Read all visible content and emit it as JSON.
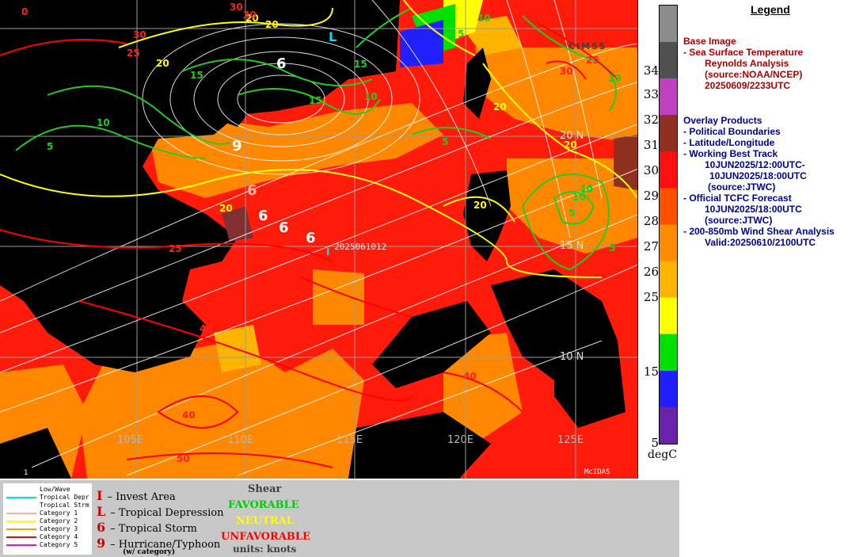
{
  "map": {
    "longitude_labels": [
      "105E",
      "110E",
      "115E",
      "120E",
      "125E"
    ],
    "latitude_labels": [
      "20 N",
      "15 N",
      "10 N"
    ],
    "track_label": "2025061012",
    "corner_label": "1",
    "footer_text": "McIDAS",
    "logo_text": "CIMSS",
    "shear_contour_labels": {
      "green": [
        "5",
        "10",
        "15",
        "10",
        "15",
        "10",
        "5",
        "10",
        "10",
        "15",
        "5",
        "5",
        "5",
        "10",
        "15"
      ],
      "yellow": [
        "20",
        "20",
        "20",
        "20",
        "20",
        "20",
        "20"
      ],
      "red": [
        "30",
        "30",
        "25",
        "25",
        "40",
        "40",
        "40",
        "50",
        "30",
        "25",
        "0",
        "30"
      ]
    }
  },
  "colorbar": {
    "ticks": [
      "34",
      "33",
      "32",
      "31",
      "30",
      "29",
      "28",
      "27",
      "26",
      "25",
      "15",
      "5"
    ],
    "unit": "degC",
    "colors": [
      "#8c8c8c",
      "#505050",
      "#c040c0",
      "#903020",
      "#ff1010",
      "#ff5000",
      "#ff8c00",
      "#ffb400",
      "#ffff00",
      "#00e000",
      "#2020ff",
      "#6a22aa"
    ]
  },
  "legend": {
    "title": "Legend",
    "base_image_header": "Base Image",
    "base_lines": [
      "-  Sea Surface Temperature",
      "Reynolds Analysis",
      "(source:NOAA/NCEP)",
      "20250609/2233UTC"
    ],
    "overlay_header": "Overlay Products",
    "overlay_lines": [
      "-  Political Boundaries",
      "-  Latitude/Longitude",
      "-  Working Best Track",
      "10JUN2025/12:00UTC-",
      "10JUN2025/18:00UTC",
      "(source:JTWC)",
      "-  Official TCFC Forecast",
      "10JUN2025/18:00UTC",
      "(source:JTWC)",
      "-  200-850mb Wind Shear Analysis",
      "Valid:20250610/2100UTC"
    ]
  },
  "storm_key": {
    "rows": [
      {
        "label": "Low/Wave",
        "color": "#ffffff"
      },
      {
        "label": "Tropical Depr",
        "color": "#00e0e0"
      },
      {
        "label": "Tropical Strm",
        "color": "#ffffff"
      },
      {
        "label": "Category 1",
        "color": "#ffb0a0"
      },
      {
        "label": "Category 2",
        "color": "#ffff00"
      },
      {
        "label": "Category 3",
        "color": "#ff9900"
      },
      {
        "label": "Category 4",
        "color": "#ff0000"
      },
      {
        "label": "Category 5",
        "color": "#ff00ff"
      }
    ]
  },
  "symbols": {
    "invest_symbol": "I",
    "invest": "– Invest Area",
    "depression_symbol": "L",
    "depression": "– Tropical Depression",
    "storm_symbol": "6",
    "storm": "– Tropical Storm",
    "hurricane_symbol": "9",
    "hurricane": "– Hurricane/Typhoon",
    "hurricane_sub": "(w/ category)"
  },
  "shear_key": {
    "title": "Shear",
    "favorable": "FAVORABLE",
    "neutral": "NEUTRAL",
    "unfavorable": "UNFAVORABLE",
    "units": "units: knots",
    "colors": {
      "favorable": "#00cc00",
      "neutral": "#ffff00",
      "unfavorable": "#ff0000"
    }
  }
}
